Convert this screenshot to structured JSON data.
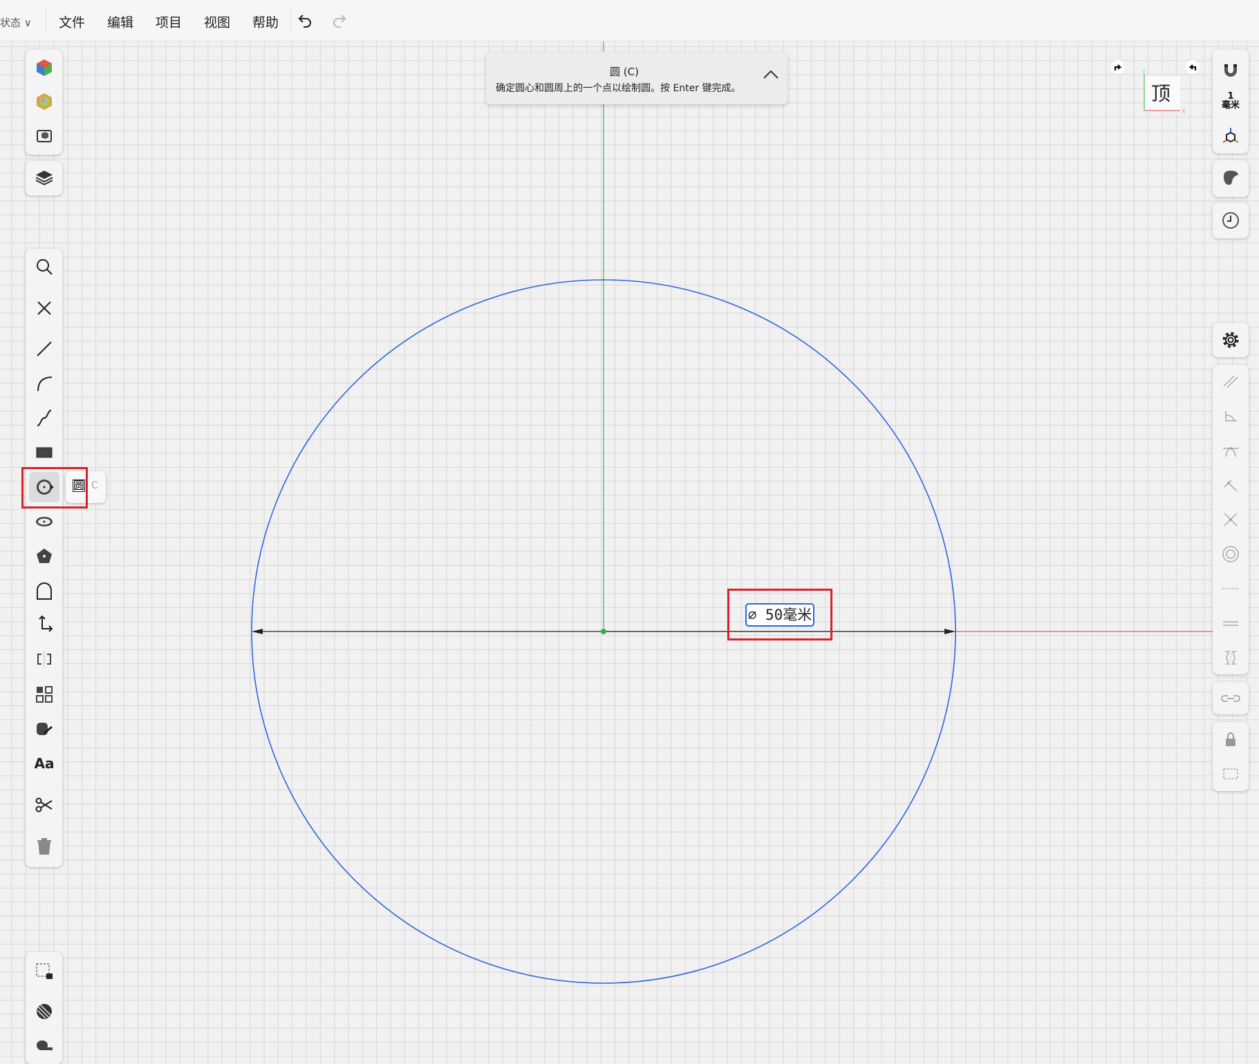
{
  "menubar": {
    "state_label": "状态",
    "items": [
      "文件",
      "编辑",
      "项目",
      "视图",
      "帮助"
    ],
    "undo_icon": "undo-icon",
    "redo_icon": "redo-icon"
  },
  "tooltip": {
    "title": "圆 (C)",
    "description": "确定圆心和圆周上的一个点以绘制圆。按 Enter 键完成。"
  },
  "view_cube": {
    "face": "顶",
    "x_axis": "X",
    "y_axis": "Y"
  },
  "right_toolbar": {
    "snap_value": "1",
    "snap_unit": "毫米"
  },
  "tool_flyout": {
    "label": "圆",
    "shortcut": "C"
  },
  "left_toolbar": {
    "text_tool_label": "Aa"
  },
  "dimension": {
    "symbol": "⌀",
    "value": "50",
    "unit": "毫米"
  },
  "colors": {
    "circle": "#2f64e0",
    "y_axis": "#5cc46a",
    "x_axis": "#e06060",
    "highlight": "#d9232b"
  }
}
